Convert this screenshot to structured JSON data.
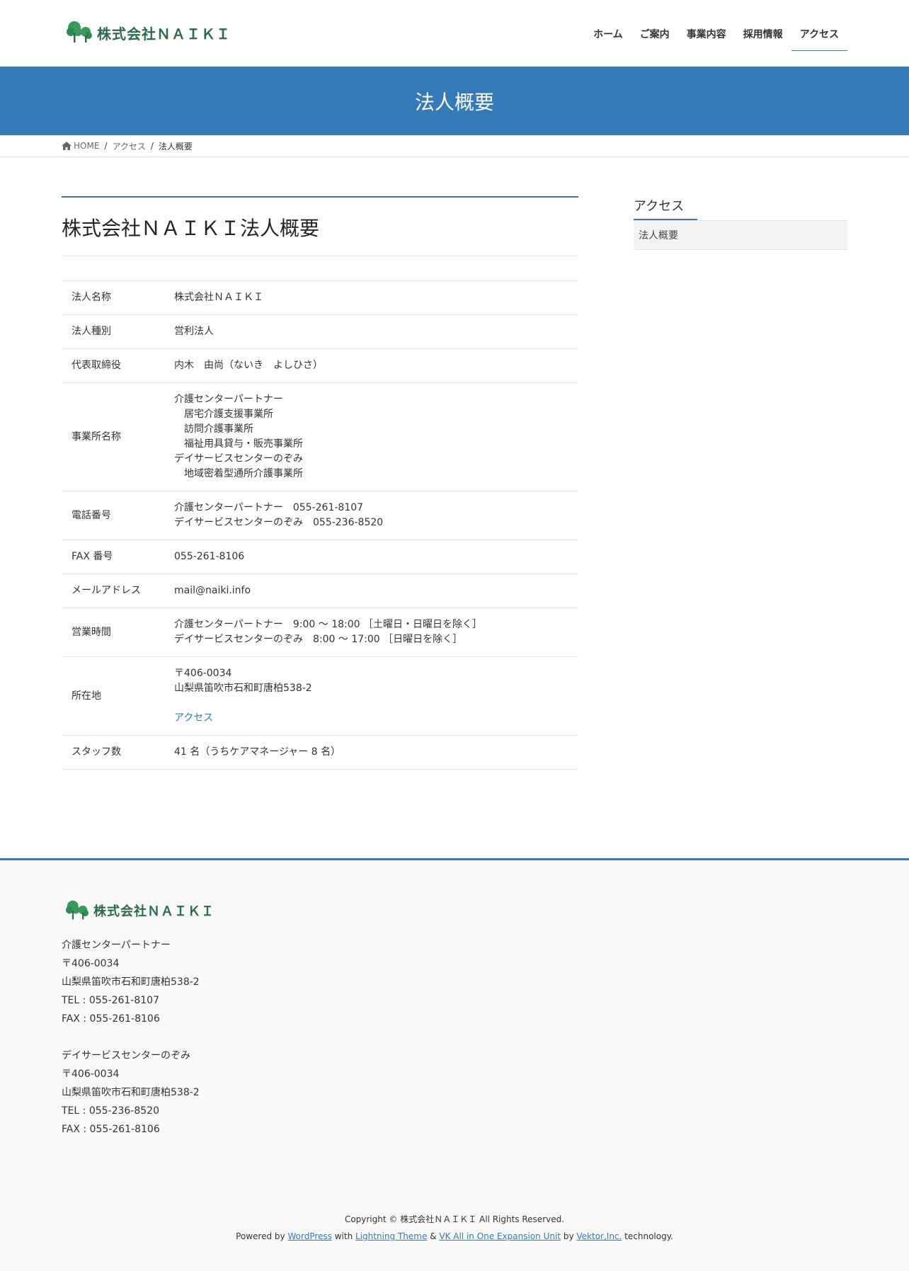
{
  "header": {
    "logo_text": "株式会社ＮＡＩＫＩ",
    "nav": [
      {
        "label": "ホーム"
      },
      {
        "label": "ご案内"
      },
      {
        "label": "事業内容"
      },
      {
        "label": "採用情報"
      },
      {
        "label": "アクセス",
        "active": true
      }
    ]
  },
  "page_header": {
    "title": "法人概要"
  },
  "breadcrumb": {
    "home": "HOME",
    "parent": "アクセス",
    "current": "法人概要",
    "separator": "/"
  },
  "content": {
    "title": "株式会社ＮＡＩＫＩ法人概要",
    "rows": [
      {
        "label": "法人名称",
        "lines": [
          "株式会社ＮＡＩＫＩ"
        ]
      },
      {
        "label": "法人種別",
        "lines": [
          "営利法人"
        ]
      },
      {
        "label": "代表取締役",
        "lines": [
          "内木　由尚（ないき　よしひさ）"
        ]
      },
      {
        "label": "事業所名称",
        "lines": [
          "介護センターパートナー",
          "　居宅介護支援事業所",
          "　訪問介護事業所",
          "　福祉用具貸与・販売事業所",
          "デイサービスセンターのぞみ",
          "　地域密着型通所介護事業所"
        ]
      },
      {
        "label": "電話番号",
        "lines": [
          "介護センターパートナー　055-261-8107",
          "デイサービスセンターのぞみ　055-236-8520"
        ]
      },
      {
        "label": "FAX 番号",
        "lines": [
          "055-261-8106"
        ]
      },
      {
        "label": "メールアドレス",
        "lines": [
          "mail@naiki.info"
        ]
      },
      {
        "label": "営業時間",
        "lines": [
          "介護センターパートナー　9:00 〜 18:00 ［土曜日・日曜日を除く］",
          "デイサービスセンターのぞみ　8:00 〜 17:00 ［日曜日を除く］"
        ]
      },
      {
        "label": "所在地",
        "lines": [
          "〒406-0034",
          "山梨県笛吹市石和町唐柏538-2"
        ],
        "link": "アクセス"
      },
      {
        "label": "スタッフ数",
        "lines": [
          "41 名（うちケアマネージャー 8 名）"
        ]
      }
    ]
  },
  "sidebar": {
    "title": "アクセス",
    "items": [
      "法人概要"
    ]
  },
  "footer": {
    "logo_text": "株式会社ＮＡＩＫＩ",
    "offices": [
      {
        "name": "介護センターパートナー",
        "zip": "〒406-0034",
        "address": "山梨県笛吹市石和町唐柏538-2",
        "tel": "TEL : 055-261-8107",
        "fax": "FAX : 055-261-8106"
      },
      {
        "name": "デイサービスセンターのぞみ",
        "zip": "〒406-0034",
        "address": "山梨県笛吹市石和町唐柏538-2",
        "tel": "TEL : 055-236-8520",
        "fax": "FAX : 055-261-8106"
      }
    ],
    "copyright": "Copyright © 株式会社ＮＡＩＫＩ All Rights Reserved.",
    "powered": {
      "prefix": "Powered by",
      "wordpress": "WordPress",
      "with": "with",
      "theme": "Lightning Theme",
      "amp": "&",
      "plugin": "VK All in One Expansion Unit",
      "by": "by",
      "vektor": "Vektor,Inc.",
      "suffix": "technology."
    }
  },
  "colors": {
    "accent": "#337ab7",
    "logo_green": "#2a6b4a",
    "tree_green": "#3a9a5c"
  },
  "icons": {
    "logo": "tree-icon",
    "breadcrumb_home": "home-icon"
  }
}
